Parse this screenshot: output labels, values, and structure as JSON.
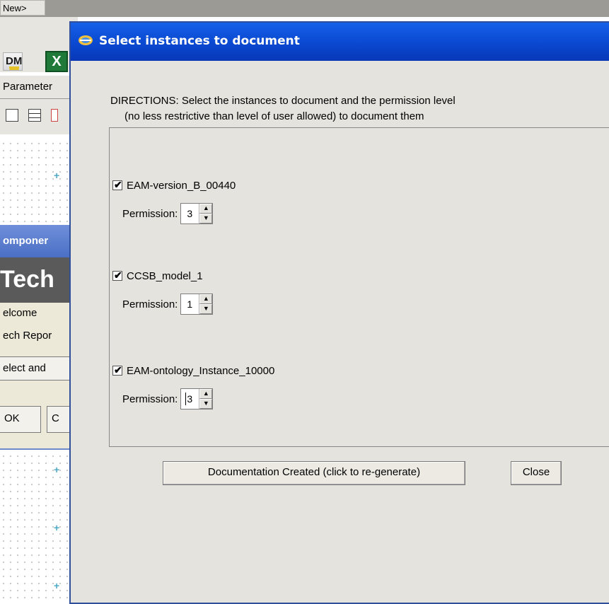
{
  "background_app": {
    "menu_new": "New>",
    "tab_parameters": "Parameter",
    "icon_dom_text": "DM",
    "icon_excel_text": "X",
    "component_dialog": {
      "title": "omponer",
      "banner": "Tech",
      "line1": "elcome",
      "line2": "ech Repor",
      "select_button": "elect and",
      "ok_button": "OK",
      "cancel_button": "C"
    }
  },
  "dialog": {
    "title": "Select instances to document",
    "directions_line1": "DIRECTIONS: Select the instances to document and the permission level",
    "directions_line2": "(no less restrictive than level of user allowed) to document them",
    "instances": [
      {
        "name": "EAM-version_B_00440",
        "checked": true,
        "permission_label": "Permission:",
        "permission": "3"
      },
      {
        "name": "CCSB_model_1",
        "checked": true,
        "permission_label": "Permission:",
        "permission": "1"
      },
      {
        "name": "EAM-ontology_Instance_10000",
        "checked": true,
        "permission_label": "Permission:",
        "permission": "3"
      }
    ],
    "generate_button": "Documentation Created (click to re-generate)",
    "close_button": "Close"
  },
  "colors": {
    "titlebar": "#0a48d0",
    "dialog_bg": "#e4e3dd",
    "background_dialog_title": "#4a6fc4"
  },
  "icons": {
    "checkmark": "✔",
    "spin_up": "▲",
    "spin_down": "▼"
  }
}
